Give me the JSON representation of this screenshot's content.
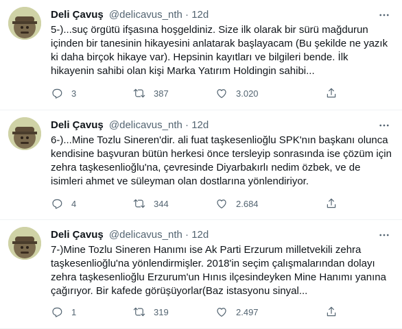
{
  "tweets": [
    {
      "name": "Deli Çavuş",
      "handle": "@delicavus_nth",
      "dot": "·",
      "time": "12d",
      "text": "5-)...suç örgütü ifşasına hoşgeldiniz. Size ilk olarak bir sürü mağdurun içinden bir tanesinin hikayesini anlatarak başlayacam (Bu şekilde ne yazık ki daha birçok hikaye var). Hepsinin kayıtları ve bilgileri bende. İlk hikayenin sahibi olan kişi Marka Yatırım Holdingin sahibi...",
      "replies": "3",
      "retweets": "387",
      "likes": "3.020"
    },
    {
      "name": "Deli Çavuş",
      "handle": "@delicavus_nth",
      "dot": "·",
      "time": "12d",
      "text": "6-)...Mine Tozlu Sineren'dir. ali fuat taşkesenlioğlu SPK'nın başkanı olunca kendisine başvuran bütün herkesi önce tersleyip sonrasında ise çözüm için zehra taşkesenlioğlu'na, çevresinde Diyarbakırlı nedim özbek, ve de isimleri ahmet ve süleyman olan dostlarına yönlendiriyor.",
      "replies": "4",
      "retweets": "344",
      "likes": "2.684"
    },
    {
      "name": "Deli Çavuş",
      "handle": "@delicavus_nth",
      "dot": "·",
      "time": "12d",
      "text": "7-)Mine Tozlu Sineren Hanımı ise Ak Parti Erzurum milletvekili zehra taşkesenlioğlu'na yönlendirmişler. 2018'in seçim çalışmalarından dolayı zehra taşkesenlioğlu Erzurum'un Hınıs ilçesindeyken Mine Hanımı yanına çağırıyor. Bir kafede görüşüyorlar(Baz istasyonu sinyal...",
      "replies": "1",
      "retweets": "319",
      "likes": "2.497"
    }
  ],
  "icons": {
    "reply": "reply-icon",
    "retweet": "retweet-icon",
    "like": "heart-icon",
    "share": "share-icon",
    "more": "more-icon"
  },
  "colors": {
    "text": "#0f1419",
    "secondary": "#536471",
    "divider": "#eff3f4"
  }
}
